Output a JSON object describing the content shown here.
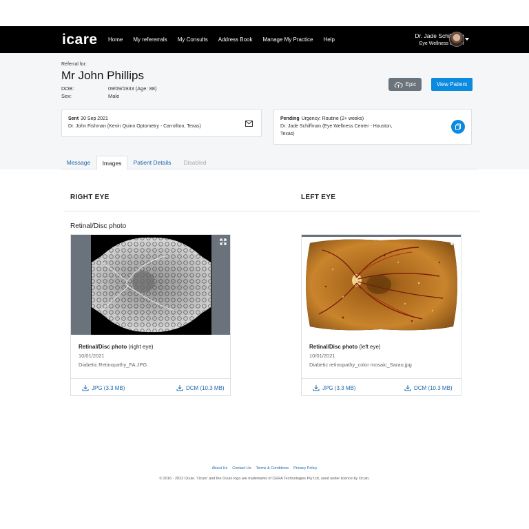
{
  "nav": {
    "logo": "icare",
    "links": [
      "Home",
      "My refererrals",
      "My Consults",
      "Address Book",
      "Manage My Practice",
      "Help"
    ],
    "user_name": "Dr. Jade Schiffman",
    "user_org": "Eye Wellness Center"
  },
  "patient": {
    "referral_for": "Referral for:",
    "name": "Mr John Phillips",
    "dob_label": "DOB:",
    "dob_value": "09/09/1933 (Age: 88)",
    "sex_label": "Sex:",
    "sex_value": "Male"
  },
  "actions": {
    "epic_label": "Epic",
    "view_patient_label": "View Patient"
  },
  "sent_card": {
    "status": "Sent",
    "date": "30 Sep 2021",
    "from": "Dr. John Fishman (Kevin Quinn Optometry - Carrollton, Texas)"
  },
  "pending_card": {
    "status": "Pending",
    "urgency": "Urgency:  Routine (2+ weeks)",
    "to_line1": "Dr. Jade Schiffman (Eye Wellness Center - Houston,",
    "to_line2": "Texas)"
  },
  "tabs": [
    "Message",
    "Images",
    "Patient Details",
    "Disabled"
  ],
  "active_tab": "Images",
  "eyes": {
    "right_heading": "RIGHT EYE",
    "left_heading": "LEFT EYE",
    "section_title": "Retinal/Disc photo"
  },
  "photos": [
    {
      "title": "Retinal/Disc photo",
      "eye": "(right eye)",
      "date": "10/01/2021",
      "filename": "Diabetic Retinopathy_FA.JPG",
      "jpg": "JPG (3.3 MB)",
      "dcm": "DCM (10.3 MB)"
    },
    {
      "title": "Retinal/Disc photo",
      "eye": "(left eye)",
      "date": "10/01/2021",
      "filename": "Diabetic retinopathy_color mosaic_Sarao.jpg",
      "jpg": "JPG (3.3 MB)",
      "dcm": "DCM (10.3 MB)"
    }
  ],
  "footer": {
    "links": [
      "About Us",
      "Contact Us",
      "Terms & Conditions",
      "Privacy Policy"
    ],
    "copyright": "© 2016 - 2022 Oculo. 'Oculo' and the Oculo logo are trademarks of CERA Technologies Pty Ltd, used under licence by Oculo."
  },
  "colors": {
    "accent": "#0b8bdf",
    "link": "#1c67a8",
    "nav_bg": "#000000",
    "header_bg": "#f4f6f8"
  }
}
